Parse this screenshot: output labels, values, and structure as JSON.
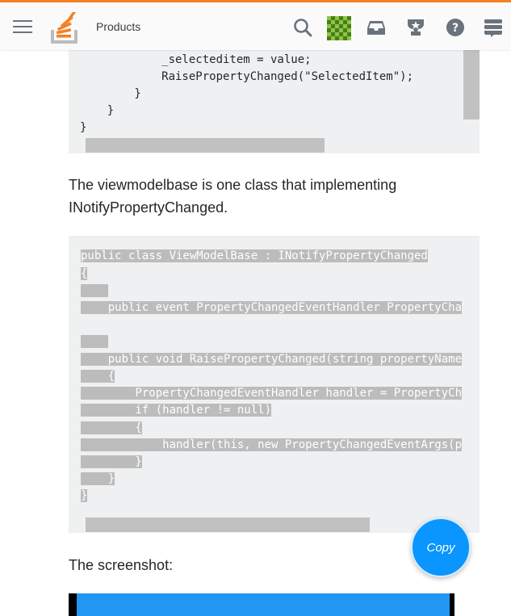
{
  "header": {
    "products_label": "Products",
    "icons": [
      "menu-icon",
      "stackoverflow-logo",
      "search-icon",
      "inbox-icon",
      "trophy-icon",
      "help-icon",
      "stack-exchange-icon"
    ],
    "accent_color": "#f48024"
  },
  "code_top": {
    "lines": [
      "            _selecteditem = value;",
      "            RaisePropertyChanged(\"SelectedItem\");",
      "        }",
      "    }",
      "}"
    ]
  },
  "paragraph1": "The viewmodelbase is one class that implementing INotifyPropertyChanged.",
  "code_main": {
    "lines": [
      "public class ViewModelBase : INotifyPropertyChanged",
      "{",
      "    ",
      "    public event PropertyChangedEventHandler PropertyCha",
      "",
      "    ",
      "    public void RaisePropertyChanged(string propertyName",
      "    {",
      "        PropertyChangedEventHandler handler = PropertyCh",
      "        if (handler != null)",
      "        {",
      "            handler(this, new PropertyChangedEventArgs(p",
      "        }",
      "    }",
      "}"
    ]
  },
  "copy_button": "Copy",
  "paragraph2": "The screenshot:"
}
